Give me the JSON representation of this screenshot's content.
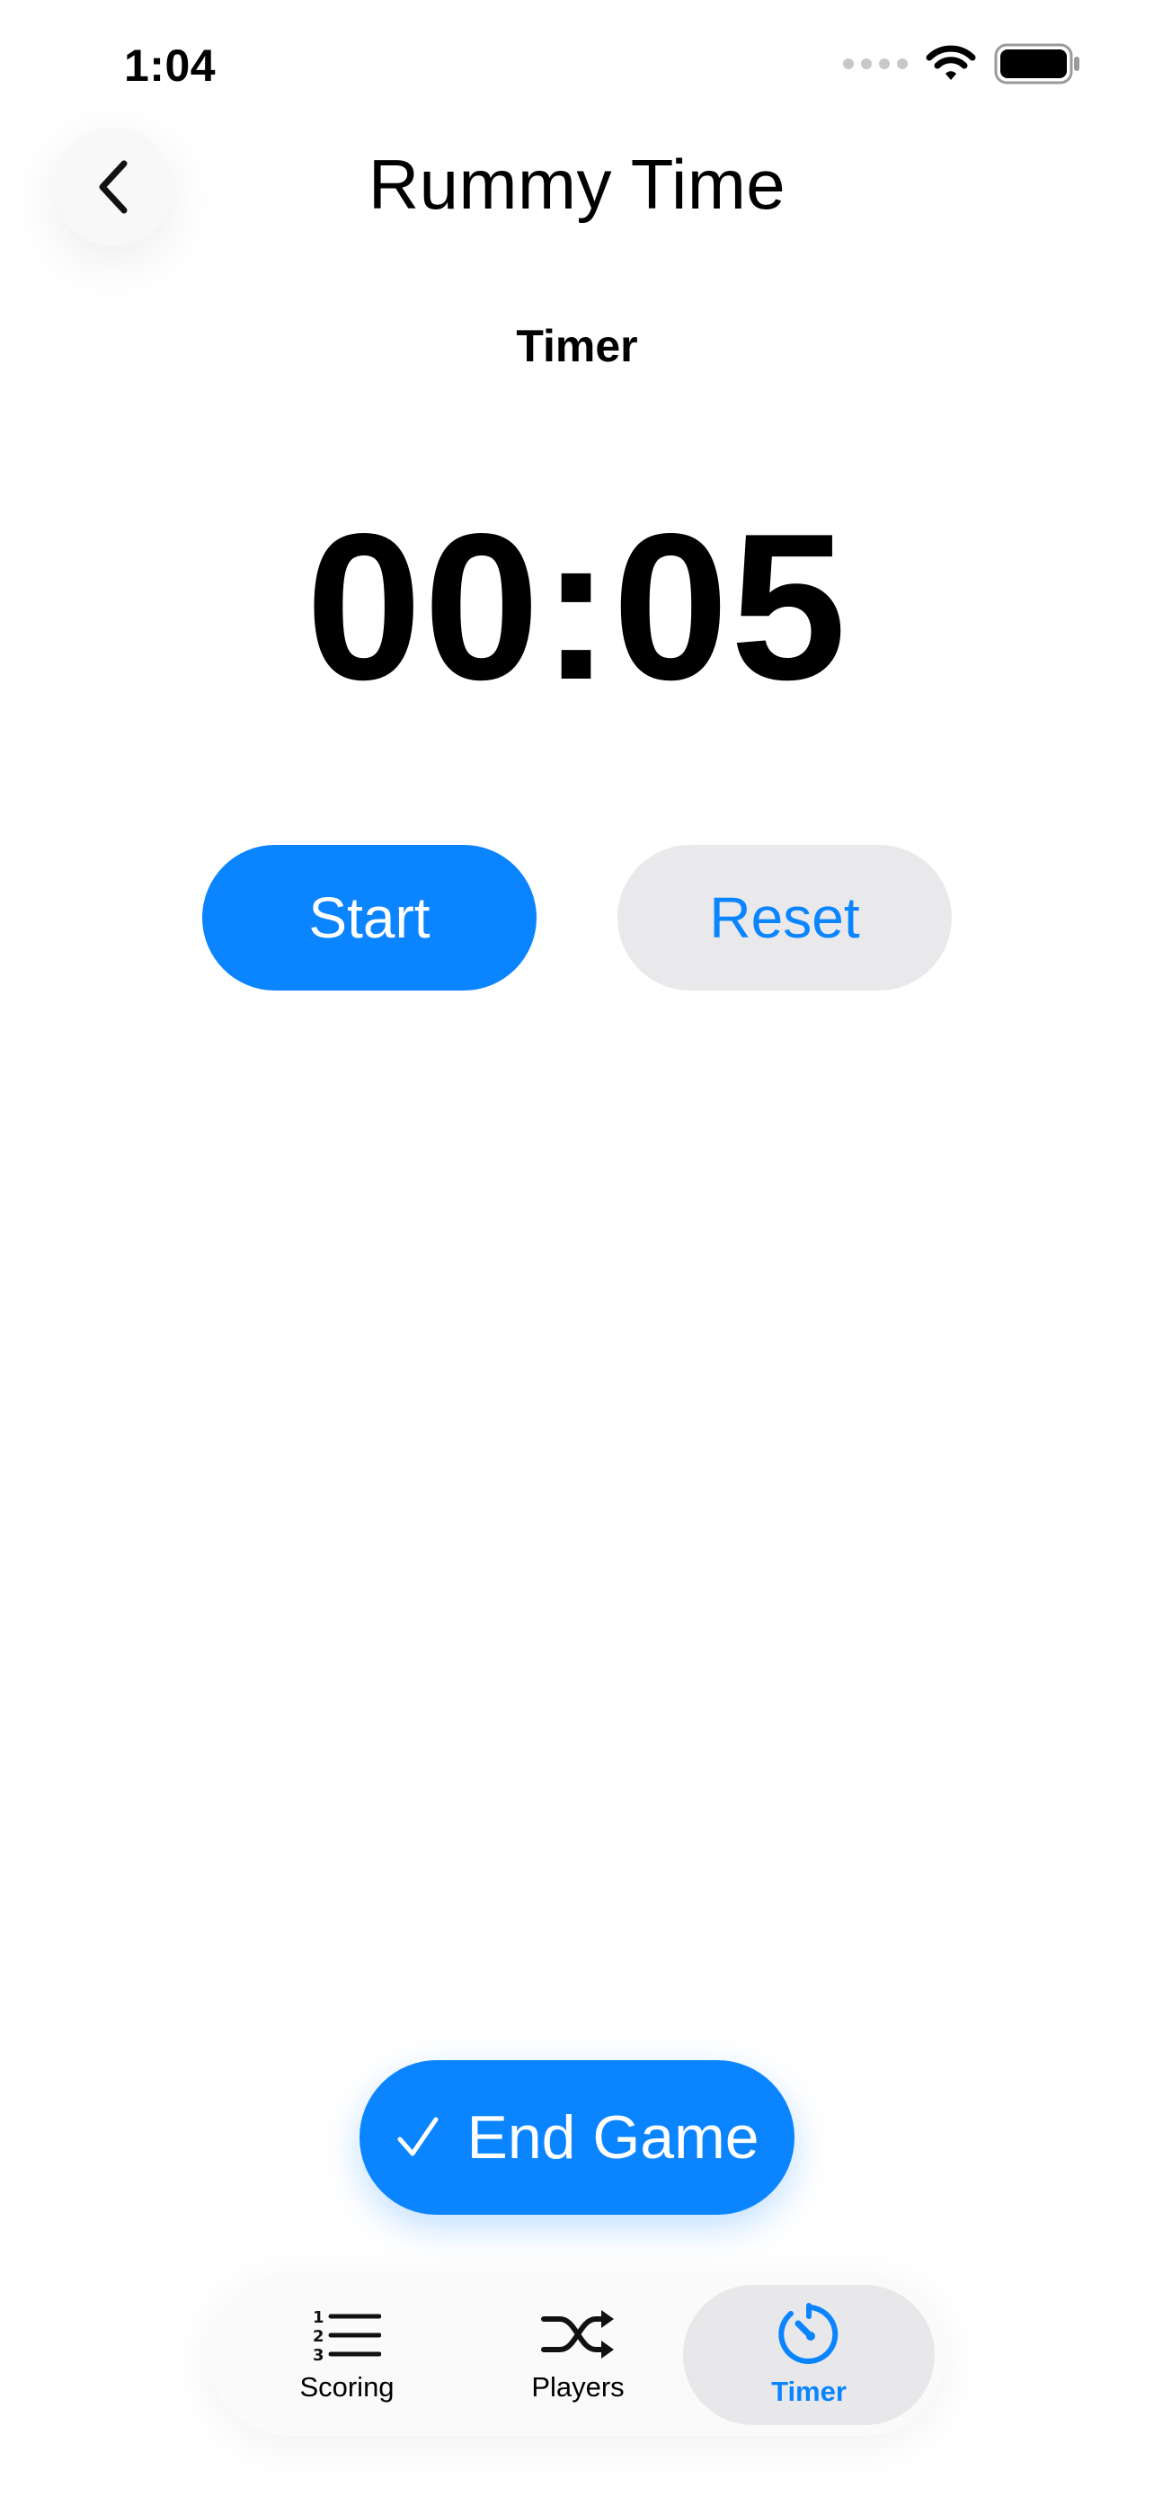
{
  "status_bar": {
    "time": "1:04"
  },
  "header": {
    "title": "Rummy Time",
    "back_icon": "chevron-left-icon"
  },
  "section": {
    "title": "Timer"
  },
  "timer": {
    "display": "00:05"
  },
  "controls": {
    "start_label": "Start",
    "reset_label": "Reset"
  },
  "end_game": {
    "label": "End Game",
    "icon": "checkmark-icon"
  },
  "tabs": [
    {
      "label": "Scoring",
      "icon": "numbered-list-icon",
      "selected": false
    },
    {
      "label": "Players",
      "icon": "shuffle-icon",
      "selected": false
    },
    {
      "label": "Timer",
      "icon": "timer-icon",
      "selected": true
    }
  ],
  "colors": {
    "accent": "#0a84ff",
    "secondary_button": "#e9e9eb",
    "selected_tab_bg": "#e8e8ea",
    "background": "#ffffff"
  }
}
